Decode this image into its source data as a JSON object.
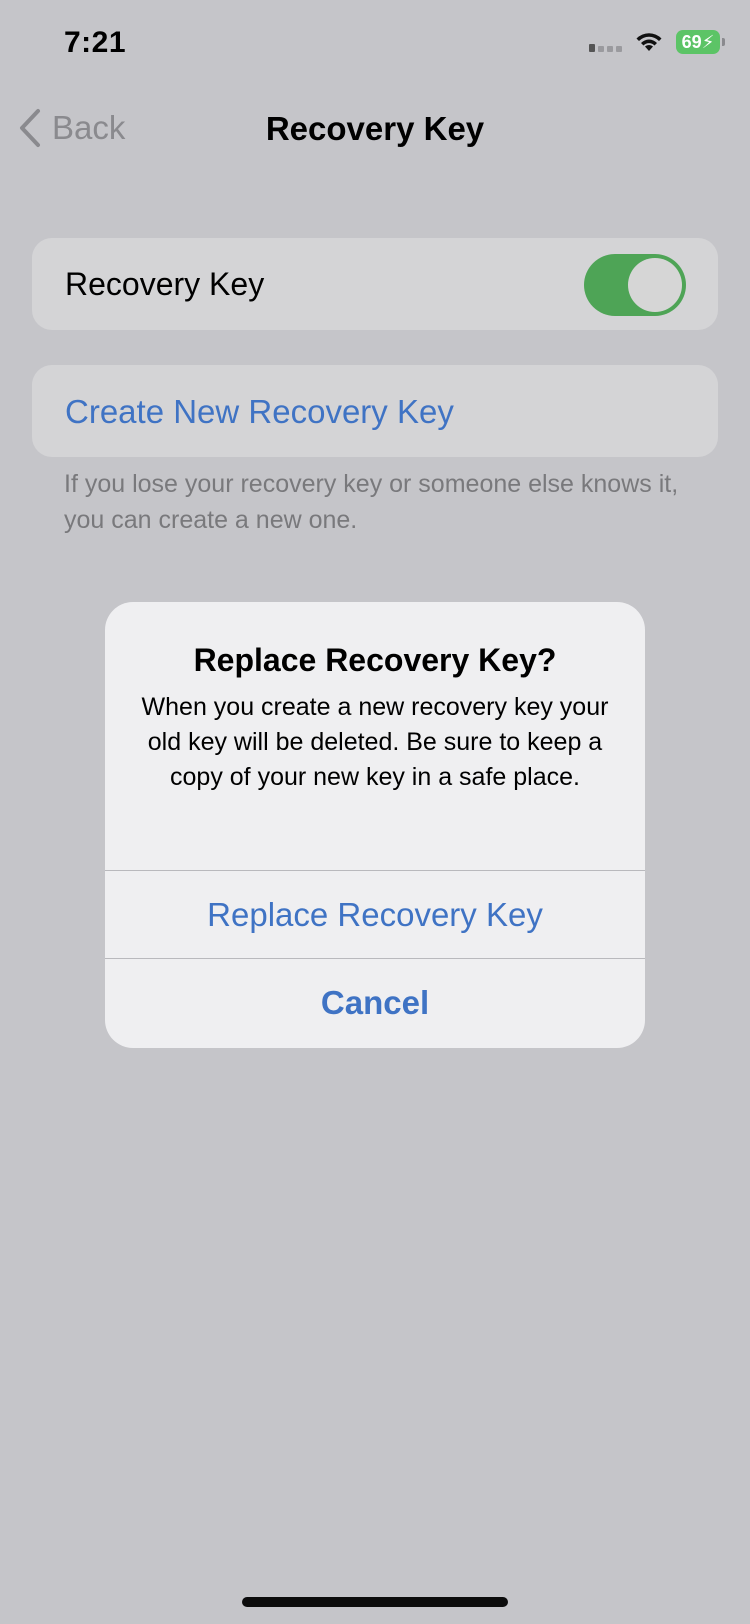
{
  "status_bar": {
    "time": "7:21",
    "battery_level": "69",
    "battery_charging": true,
    "icons": [
      "signal-icon",
      "wifi-icon",
      "battery-icon"
    ]
  },
  "nav": {
    "back_label": "Back",
    "title": "Recovery Key"
  },
  "settings": {
    "toggle_row": {
      "label": "Recovery Key",
      "enabled": true
    },
    "create_link": "Create New Recovery Key",
    "footer": "If you lose your recovery key or someone else knows it, you can create a new one."
  },
  "alert": {
    "title": "Replace Recovery Key?",
    "message": "When you create a new recovery key your old key will be deleted. Be sure to keep a copy of your new key in a safe place.",
    "primary_button": "Replace Recovery Key",
    "cancel_button": "Cancel"
  },
  "colors": {
    "accent": "#3f73c4",
    "toggle_on": "#4ea456",
    "background": "#c5c5c9"
  }
}
